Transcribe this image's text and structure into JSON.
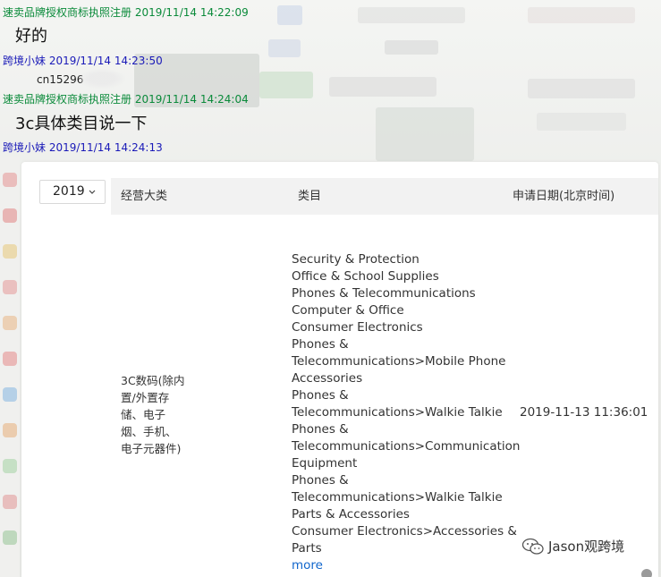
{
  "chat": {
    "messages": [
      {
        "sender": "速卖品牌授权商标执照注册",
        "time": "2019/11/14 14:22:09",
        "text": "好的"
      },
      {
        "sender": "跨境小妹",
        "time": "2019/11/14 14:23:50",
        "text": "cn15296"
      },
      {
        "sender": "速卖品牌授权商标执照注册",
        "time": "2019/11/14 14:24:04",
        "text": "3c具体类目说一下"
      },
      {
        "sender": "跨境小妹",
        "time": "2019/11/14 14:24:13",
        "text": ""
      }
    ],
    "colors": {
      "seller": "#0a8a3a",
      "buyer": "#1a1ab8"
    }
  },
  "embedded": {
    "year_select": {
      "value": "2019",
      "icon": "chevron-down-icon"
    },
    "table": {
      "headers": [
        "经营大类",
        "类目",
        "申请日期(北京时间)"
      ],
      "row": {
        "category": "3C数码(除内置/外置存储、电子烟、手机、电子元器件)",
        "category_lines": [
          "3C数码(除内",
          "置/外置存",
          "储、电子",
          "烟、手机、",
          "电子元器件)"
        ],
        "subcategory_lines": [
          "Security & Protection",
          "Office & School Supplies",
          "Phones & Telecommunications",
          "Computer & Office",
          "Consumer Electronics",
          "Phones &",
          "Telecommunications>Mobile Phone",
          "Accessories",
          "Phones &",
          "Telecommunications>Walkie Talkie",
          "Phones &",
          "Telecommunications>Communication",
          "Equipment",
          "Phones &",
          "Telecommunications>Walkie Talkie",
          "Parts & Accessories",
          "Consumer Electronics>Accessories &",
          "Parts"
        ],
        "more_label": "more",
        "date": "2019-11-13 11:36:01"
      },
      "link_color": "#1166cc"
    }
  },
  "watermark": {
    "text": "Jason观跨境",
    "icon": "wechat-icon"
  }
}
